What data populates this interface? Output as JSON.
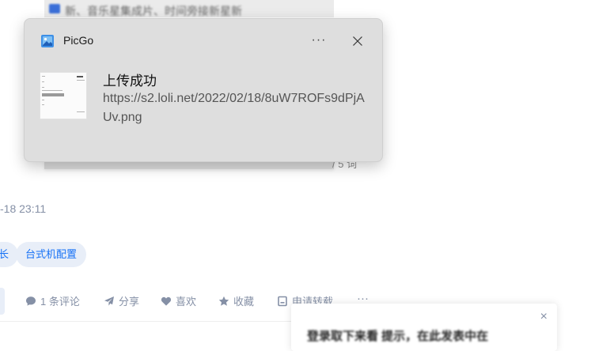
{
  "notification": {
    "app_name": "PicGo",
    "more_label": "···",
    "title": "上传成功",
    "body": "https://s2.loli.net/2022/02/18/8uW7ROFs9dPjAUv.png"
  },
  "background": {
    "top_strip_text": "新、音乐星集成片、时间旁接新星新",
    "word_count": "/ 5 词",
    "post_time": "-18 23:11",
    "tags": [
      "长",
      "台式机配置"
    ],
    "actions": {
      "comments": "1 条评论",
      "share": "分享",
      "like": "喜欢",
      "collect": "收藏",
      "reprint": "申请转载",
      "more": "···"
    },
    "popup": {
      "close": "×",
      "text": "登录取下来看 提示，在此发表中在"
    }
  },
  "colors": {
    "accent": "#1772f6",
    "muted": "#8590a6",
    "toast_bg": "#dedede"
  }
}
